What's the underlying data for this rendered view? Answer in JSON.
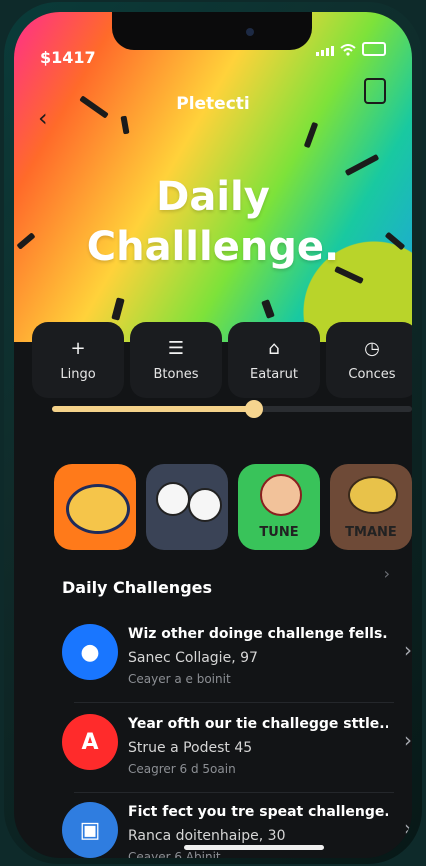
{
  "status": {
    "time": "$1417"
  },
  "header": {
    "title": "Pletecti"
  },
  "hero": {
    "headline_line1": "Daily",
    "headline_line2": "Challlenge."
  },
  "tabs": [
    {
      "icon": "plus-icon",
      "label": "Lingo"
    },
    {
      "icon": "document-icon",
      "label": "Btones"
    },
    {
      "icon": "home-icon",
      "label": "Eatarut"
    },
    {
      "icon": "clock-icon",
      "label": "Conces"
    }
  ],
  "slider": {
    "value": 0.56
  },
  "tiles": [
    {
      "label": "",
      "color": "#ff7a1a"
    },
    {
      "label": "",
      "color": "#3a4356"
    },
    {
      "label": "TUNE",
      "color": "#39c35a"
    },
    {
      "label": "TMANE",
      "color": "#6e4a37"
    }
  ],
  "section": {
    "title": "Daily Challenges"
  },
  "challenges": [
    {
      "title": "Wiz other doinge challenge fells..",
      "subtitle": "Sanec Collagie, 97",
      "meta": "Ceayer a e boinit",
      "avatar_color": "#1976ff"
    },
    {
      "title": "Year ofth our tie challegge sttle...",
      "subtitle": "Strue a Podest 45",
      "meta": "Ceagrer 6 d 5oain",
      "avatar_color": "#ff2b2b"
    },
    {
      "title": "Fict fect you tre speat challenge...",
      "subtitle": "Ranca doitenhaipe, 30",
      "meta": "Ceayer 6 Abinit",
      "avatar_color": "#2f7de0"
    }
  ]
}
